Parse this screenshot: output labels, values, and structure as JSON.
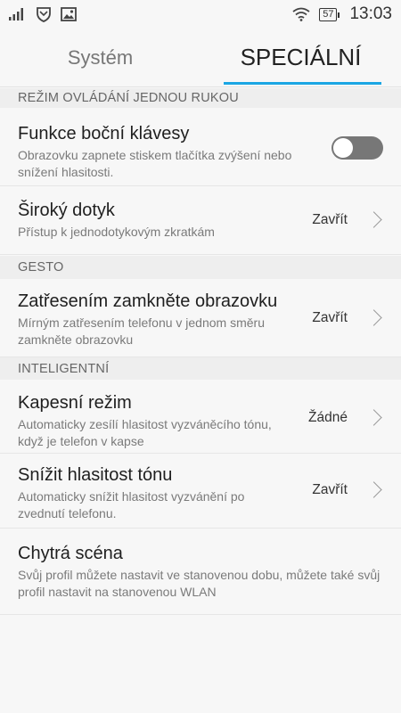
{
  "statusbar": {
    "time": "13:03",
    "battery": "57",
    "icons": [
      "signal-icon",
      "shield-icon",
      "image-icon",
      "wifi-icon",
      "battery-icon"
    ]
  },
  "tabs": [
    {
      "label": "Systém",
      "selected": false
    },
    {
      "label": "SPECIÁLNÍ",
      "selected": true
    }
  ],
  "accent_color": "#1aa6e4",
  "sections": {
    "one_hand": "REŽIM OVLÁDÁNÍ JEDNOU RUKOU",
    "gesture": "GESTO",
    "intelligent": "INTELIGENTNÍ"
  },
  "items": {
    "side_key": {
      "title": "Funkce boční klávesy",
      "subtitle": "Obrazovku zapnete stiskem tlačítka zvýšení nebo snížení hlasitosti.",
      "toggle_on": false
    },
    "wide_touch": {
      "title": "Široký dotyk",
      "subtitle": "Přístup k jednodotykovým zkratkám",
      "value": "Zavřít"
    },
    "shake_lock": {
      "title": "Zatřesením zamkněte obrazovku",
      "subtitle": "Mírným zatřesením telefonu v jednom směru zamkněte obrazovku",
      "value": "Zavřít"
    },
    "pocket": {
      "title": "Kapesní režim",
      "subtitle": "Automaticky zesílí hlasitost vyzváněcího tónu, když je telefon v kapse",
      "value": "Žádné"
    },
    "lower_tone": {
      "title": "Snížit hlasitost tónu",
      "subtitle": "Automaticky snížit hlasitost vyzvánění po zvednutí telefonu.",
      "value": "Zavřít"
    },
    "smart_scene": {
      "title": "Chytrá scéna",
      "subtitle": "Svůj profil můžete nastavit ve stanovenou dobu, můžete také svůj profil nastavit na stanovenou WLAN"
    }
  }
}
